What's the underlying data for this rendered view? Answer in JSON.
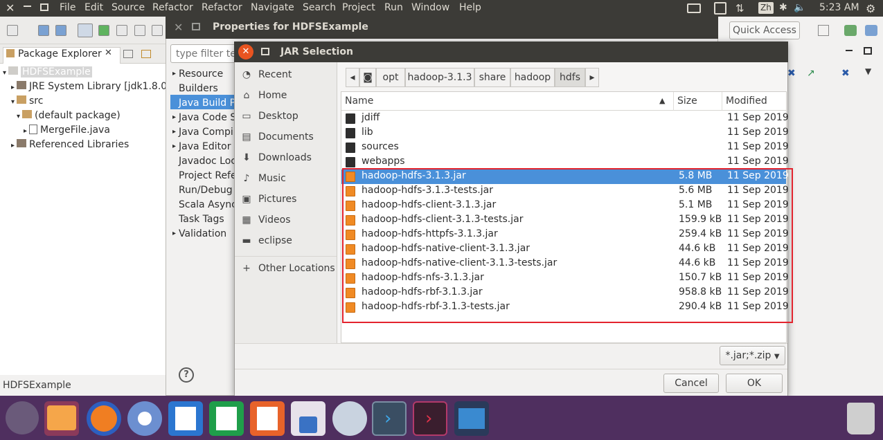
{
  "menubar": {
    "items": [
      "File",
      "Edit",
      "Source",
      "Refactor",
      "Refactor",
      "Navigate",
      "Search",
      "Project",
      "Run",
      "Window",
      "Help"
    ],
    "input_indicator": "Zh",
    "time": "5:23 AM"
  },
  "eclipse": {
    "quick_access": "Quick Access",
    "package_explorer": {
      "tab_label": "Package Explorer",
      "tree": [
        {
          "label": "HDFSExample"
        },
        {
          "label": "JRE System Library [jdk1.8.0_"
        },
        {
          "label": "src"
        },
        {
          "label": "(default package)"
        },
        {
          "label": "MergeFile.java"
        },
        {
          "label": "Referenced Libraries"
        }
      ]
    },
    "status_text": "HDFSExample"
  },
  "properties": {
    "title": "Properties for HDFSExample",
    "filter_placeholder": "type filter te",
    "nav": [
      "Resource",
      "Builders",
      "Java Build P",
      "Java Code S",
      "Java Compi",
      "Java Editor",
      "Javadoc Loc",
      "Project Refe",
      "Run/Debug",
      "Scala Async",
      "Task Tags",
      "Validation"
    ]
  },
  "jar_dialog": {
    "title": "JAR Selection",
    "sidebar": [
      {
        "label": "Recent",
        "icon": "clock-icon"
      },
      {
        "label": "Home",
        "icon": "home-icon"
      },
      {
        "label": "Desktop",
        "icon": "desktop-icon"
      },
      {
        "label": "Documents",
        "icon": "document-icon"
      },
      {
        "label": "Downloads",
        "icon": "download-icon"
      },
      {
        "label": "Music",
        "icon": "music-icon"
      },
      {
        "label": "Pictures",
        "icon": "picture-icon"
      },
      {
        "label": "Videos",
        "icon": "video-icon"
      },
      {
        "label": "eclipse",
        "icon": "drive-icon"
      },
      {
        "label": "Other Locations",
        "icon": "plus-icon"
      }
    ],
    "path": [
      "opt",
      "hadoop-3.1.3",
      "share",
      "hadoop",
      "hdfs"
    ],
    "columns": {
      "name": "Name",
      "size": "Size",
      "modified": "Modified"
    },
    "files": [
      {
        "name": "jdiff",
        "size": "",
        "modified": "11 Sep 2019",
        "type": "folder"
      },
      {
        "name": "lib",
        "size": "",
        "modified": "11 Sep 2019",
        "type": "folder"
      },
      {
        "name": "sources",
        "size": "",
        "modified": "11 Sep 2019",
        "type": "folder"
      },
      {
        "name": "webapps",
        "size": "",
        "modified": "11 Sep 2019",
        "type": "folder"
      },
      {
        "name": "hadoop-hdfs-3.1.3.jar",
        "size": "5.8 MB",
        "modified": "11 Sep 2019",
        "type": "jar",
        "selected": true
      },
      {
        "name": "hadoop-hdfs-3.1.3-tests.jar",
        "size": "5.6 MB",
        "modified": "11 Sep 2019",
        "type": "jar"
      },
      {
        "name": "hadoop-hdfs-client-3.1.3.jar",
        "size": "5.1 MB",
        "modified": "11 Sep 2019",
        "type": "jar"
      },
      {
        "name": "hadoop-hdfs-client-3.1.3-tests.jar",
        "size": "159.9 kB",
        "modified": "11 Sep 2019",
        "type": "jar"
      },
      {
        "name": "hadoop-hdfs-httpfs-3.1.3.jar",
        "size": "259.4 kB",
        "modified": "11 Sep 2019",
        "type": "jar"
      },
      {
        "name": "hadoop-hdfs-native-client-3.1.3.jar",
        "size": "44.6 kB",
        "modified": "11 Sep 2019",
        "type": "jar"
      },
      {
        "name": "hadoop-hdfs-native-client-3.1.3-tests.jar",
        "size": "44.6 kB",
        "modified": "11 Sep 2019",
        "type": "jar"
      },
      {
        "name": "hadoop-hdfs-nfs-3.1.3.jar",
        "size": "150.7 kB",
        "modified": "11 Sep 2019",
        "type": "jar"
      },
      {
        "name": "hadoop-hdfs-rbf-3.1.3.jar",
        "size": "958.8 kB",
        "modified": "11 Sep 2019",
        "type": "jar"
      },
      {
        "name": "hadoop-hdfs-rbf-3.1.3-tests.jar",
        "size": "290.4 kB",
        "modified": "11 Sep 2019",
        "type": "jar"
      }
    ],
    "filter_select": "*.jar;*.zip",
    "cancel_label": "Cancel",
    "ok_label": "OK",
    "selection_color": "#4a90d9",
    "highlight_color": "#e3232d"
  },
  "dock": {
    "apps": [
      "ubuntu-logo-icon",
      "files-icon",
      "firefox-icon",
      "chromium-icon",
      "writer-icon",
      "calc-icon",
      "impress-icon",
      "software-center-icon",
      "vpn-icon",
      "vscode-icon",
      "terminal-icon",
      "workspace-icon"
    ],
    "trash": "trash-icon"
  }
}
